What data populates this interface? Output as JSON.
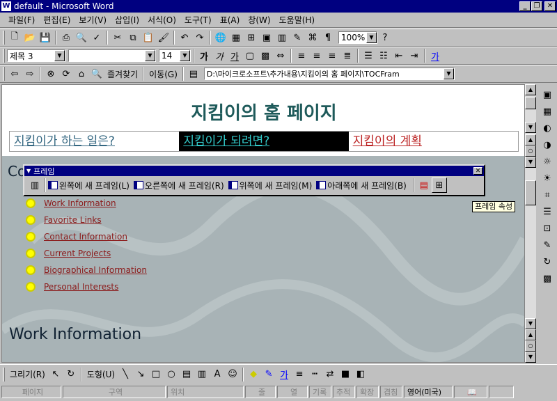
{
  "window": {
    "title": "default - Microsoft Word"
  },
  "menu": [
    "파일(F)",
    "편집(E)",
    "보기(V)",
    "삽입(I)",
    "서식(O)",
    "도구(T)",
    "표(A)",
    "창(W)",
    "도움말(H)"
  ],
  "standard": {
    "zoom": "100%"
  },
  "formatting": {
    "style": "제목 3",
    "font": "",
    "size": "14"
  },
  "web": {
    "favorites": "즐겨찾기",
    "go": "이동(G)",
    "address": "D:\\마이크로소프트\\추가내용\\지킴이의 홈 페이지\\TOCFram"
  },
  "page": {
    "title": "지킴이의 홈 페이지",
    "nav": [
      "지킴이가 하는 일은?",
      "지킴이가 되려면?",
      "지킴이의 계획"
    ],
    "contents_heading": "Co",
    "links": [
      "Work Information",
      "Favorite Links",
      "Contact Information",
      "Current Projects",
      "Biographical Information",
      "Personal Interests"
    ],
    "work_heading": "Work Information"
  },
  "frames_toolbar": {
    "title": "프레임",
    "buttons": [
      "왼쪽에 새 프레임(L)",
      "오른쪽에 새 프레임(R)",
      "위쪽에 새 프레임(M)",
      "아래쪽에 새 프레임(B)"
    ],
    "tooltip": "프레임 속성"
  },
  "drawing": {
    "draw": "그리기(R)",
    "autoshapes": "도형(U)"
  },
  "status": {
    "page": "페이지",
    "section": "구역",
    "at": "위치",
    "ln": "줄",
    "col": "열",
    "rec": "기록",
    "trk": "추적",
    "ext": "확장",
    "ovr": "겹침",
    "lang": "영어(미국)"
  }
}
